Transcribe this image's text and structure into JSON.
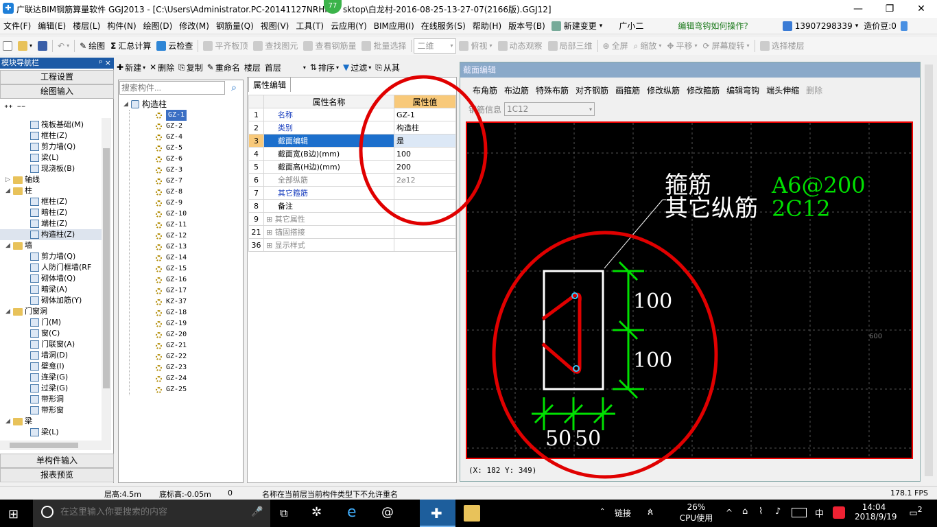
{
  "window": {
    "title": "广联达BIM钢筋算量软件 GGJ2013 - [C:\\Users\\Administrator.PC-20141127NRHI\\Desktop\\白龙村-2016-08-25-13-27-07(2166版).GGJ12]",
    "title_left": "广联达BIM钢筋算量软件 GGJ2013 - [C:\\Users\\Administrator.PC-20141127NRHI",
    "title_right": "sktop\\白龙村-2016-08-25-13-27-07(2166版).GGJ12]",
    "badge": "77"
  },
  "menu": [
    "文件(F)",
    "编辑(E)",
    "楼层(L)",
    "构件(N)",
    "绘图(D)",
    "修改(M)",
    "钢筋量(Q)",
    "视图(V)",
    "工具(T)",
    "云应用(Y)",
    "BIM应用(I)",
    "在线服务(S)",
    "帮助(H)",
    "版本号(B)"
  ],
  "menu_right": {
    "new_change": "新建变更",
    "user_nick": "广小二",
    "help_link": "编辑弯钩如何操作?",
    "phone": "13907298339",
    "beans": "造价豆:0"
  },
  "toolbar1": {
    "draw": "绘图",
    "sum": "汇总计算",
    "cloud_check": "云检查",
    "flush_top": "平齐板顶",
    "find_elem": "查找图元",
    "view_rebar": "查看钢筋量",
    "batch_select": "批量选择",
    "view_mode": "二维",
    "top_view": "俯视",
    "dynamic": "动态观察",
    "local3d": "局部三维",
    "fullscreen": "全屏",
    "zoom": "缩放",
    "pan": "平移",
    "rotate": "屏幕旋转",
    "select_floor": "选择楼层"
  },
  "nav": {
    "header": "模块导航栏",
    "pin": "ᵖ ×",
    "btn_project": "工程设置",
    "btn_draw_input": "绘图输入",
    "btn_single": "单构件输入",
    "btn_report": "报表预览",
    "tree": [
      {
        "label": "筏板基础(M)",
        "level": 2
      },
      {
        "label": "框柱(Z)",
        "level": 2
      },
      {
        "label": "剪力墙(Q)",
        "level": 2
      },
      {
        "label": "梁(L)",
        "level": 2
      },
      {
        "label": "现浇板(B)",
        "level": 2
      },
      {
        "label": "轴线",
        "level": 1,
        "folder": true,
        "exp": "▷"
      },
      {
        "label": "柱",
        "level": 1,
        "folder": true,
        "exp": "◢"
      },
      {
        "label": "框柱(Z)",
        "level": 2
      },
      {
        "label": "暗柱(Z)",
        "level": 2
      },
      {
        "label": "端柱(Z)",
        "level": 2
      },
      {
        "label": "构造柱(Z)",
        "level": 2,
        "selected": true
      },
      {
        "label": "墙",
        "level": 1,
        "folder": true,
        "exp": "◢"
      },
      {
        "label": "剪力墙(Q)",
        "level": 2
      },
      {
        "label": "人防门框墙(RF",
        "level": 2
      },
      {
        "label": "砌体墙(Q)",
        "level": 2
      },
      {
        "label": "暗梁(A)",
        "level": 2
      },
      {
        "label": "砌体加筋(Y)",
        "level": 2
      },
      {
        "label": "门窗洞",
        "level": 1,
        "folder": true,
        "exp": "◢"
      },
      {
        "label": "门(M)",
        "level": 2
      },
      {
        "label": "窗(C)",
        "level": 2
      },
      {
        "label": "门联窗(A)",
        "level": 2
      },
      {
        "label": "墙洞(D)",
        "level": 2
      },
      {
        "label": "壁龛(I)",
        "level": 2
      },
      {
        "label": "连梁(G)",
        "level": 2
      },
      {
        "label": "过梁(G)",
        "level": 2
      },
      {
        "label": "带形洞",
        "level": 2
      },
      {
        "label": "带形窗",
        "level": 2
      },
      {
        "label": "梁",
        "level": 1,
        "folder": true,
        "exp": "◢"
      },
      {
        "label": "梁(L)",
        "level": 2
      }
    ]
  },
  "comp_toolbar": {
    "new": "新建",
    "delete": "删除",
    "copy": "复制",
    "rename": "重命名",
    "floor_label": "楼层",
    "floor_value": "首层",
    "sort": "排序",
    "filter": "过滤",
    "from": "从其"
  },
  "complist": {
    "search_placeholder": "搜索构件...",
    "root": "构造柱",
    "items": [
      "GZ-1",
      "GZ-2",
      "GZ-4",
      "GZ-5",
      "GZ-6",
      "GZ-3",
      "GZ-7",
      "GZ-8",
      "GZ-9",
      "GZ-10",
      "GZ-11",
      "GZ-12",
      "GZ-13",
      "GZ-14",
      "GZ-15",
      "GZ-16",
      "GZ-17",
      "KZ-37",
      "GZ-18",
      "GZ-19",
      "GZ-20",
      "GZ-21",
      "GZ-22",
      "GZ-23",
      "GZ-24",
      "GZ-25"
    ]
  },
  "props": {
    "tab": "属性编辑",
    "col_name": "属性名称",
    "col_value": "属性值",
    "rows": [
      {
        "no": "1",
        "name": "名称",
        "value": "GZ-1",
        "blue": true
      },
      {
        "no": "2",
        "name": "类别",
        "value": "构造柱",
        "blue": true
      },
      {
        "no": "3",
        "name": "截面编辑",
        "value": "是",
        "selected": true
      },
      {
        "no": "4",
        "name": "截面宽(B边)(mm)",
        "value": "100"
      },
      {
        "no": "5",
        "name": "截面高(H边)(mm)",
        "value": "200"
      },
      {
        "no": "6",
        "name": "全部纵筋",
        "value": "2⌀12",
        "gray": true
      },
      {
        "no": "7",
        "name": "其它箍筋",
        "value": "",
        "blue": true
      },
      {
        "no": "8",
        "name": "备注",
        "value": ""
      },
      {
        "no": "9",
        "name": "其它属性",
        "value": "",
        "group": true
      },
      {
        "no": "21",
        "name": "锚固搭接",
        "value": "",
        "group": true
      },
      {
        "no": "36",
        "name": "显示样式",
        "value": "",
        "group": true
      }
    ]
  },
  "section": {
    "title": "截面编辑",
    "tools": [
      "布角筋",
      "布边筋",
      "特殊布筋",
      "对齐钢筋",
      "画箍筋",
      "修改纵筋",
      "修改箍筋",
      "编辑弯钩",
      "端头伸缩",
      "删除"
    ],
    "rebar_info_label": "钢筋信息",
    "rebar_info_value": "1C12",
    "stirrup_label": "箍筋",
    "stirrup_value": "A6@200",
    "other_label": "其它纵筋",
    "other_value": "2C12",
    "dim_h1": "100",
    "dim_h2": "100",
    "dim_w1": "50",
    "dim_w2": "50",
    "axis_label": "600",
    "coords": "(X: 182 Y: 349)"
  },
  "status": {
    "floor_height": "层高:4.5m",
    "base_height": "底标高:-0.05m",
    "zero": "0",
    "message": "名称在当前层当前构件类型下不允许重名",
    "fps": "178.1 FPS"
  },
  "taskbar": {
    "search_placeholder": "在这里输入你要搜索的内容",
    "link": "链接",
    "cpu_pct": "26%",
    "cpu_label": "CPU使用",
    "ime": "中",
    "time": "14:04",
    "date": "2018/9/19",
    "notif": "2"
  },
  "colors": {
    "accent_blue": "#1c5aa6",
    "section_red": "#e00000",
    "rebar_green": "#00e000",
    "annotation_red": "#e00000"
  }
}
